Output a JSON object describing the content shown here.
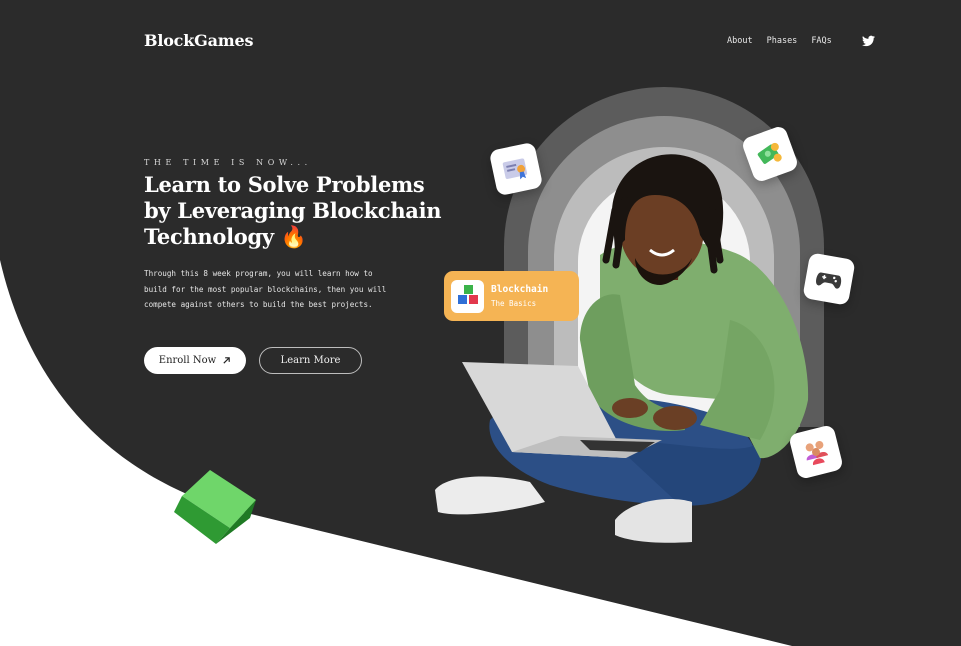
{
  "header": {
    "logo": "BlockGames",
    "nav": [
      "About",
      "Phases",
      "FAQs"
    ],
    "social_icon": "twitter-icon"
  },
  "hero": {
    "eyebrow": "THE TIME IS NOW...",
    "headline": "Learn to Solve Problems by Leveraging Blockchain Technology 🔥",
    "description": "Through this 8 week program, you will learn how to build for the most popular blockchains, then you will compete against others to build the best projects.",
    "enroll_label": "Enroll Now",
    "learn_label": "Learn More"
  },
  "card": {
    "title": "Blockchain",
    "subtitle": "The Basics"
  },
  "colors": {
    "dark_bg": "#2b2b2b",
    "accent_orange": "#f5b454",
    "cube_green": "#2f9a33"
  },
  "icons": [
    "certificate-icon",
    "money-icon",
    "gamepad-icon",
    "people-icon",
    "blocks-icon",
    "cube-icon",
    "flame-icon"
  ]
}
